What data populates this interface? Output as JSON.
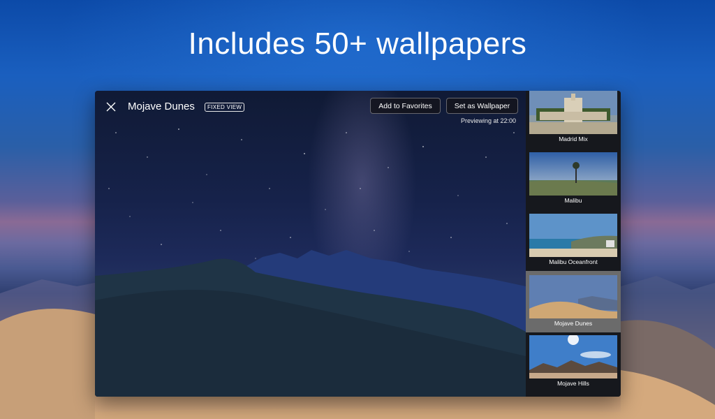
{
  "headline": "Includes 50+ wallpapers",
  "window": {
    "title": "Mojave Dunes",
    "badge": "FIXED VIEW",
    "add_favorites_label": "Add to Favorites",
    "set_wallpaper_label": "Set as Wallpaper",
    "previewing_text": "Previewing at 22:00"
  },
  "sidebar": {
    "items": [
      {
        "label": "Madrid Mix",
        "selected": false
      },
      {
        "label": "Malibu",
        "selected": false
      },
      {
        "label": "Malibu Oceanfront",
        "selected": false
      },
      {
        "label": "Mojave Dunes",
        "selected": true
      },
      {
        "label": "Mojave Hills",
        "selected": false
      }
    ]
  },
  "colors": {
    "sky_top": "#0c4aa8",
    "sand": "#d6ab82",
    "selected_bg": "#6b6b6b",
    "sidebar_bg": "#16181d"
  }
}
